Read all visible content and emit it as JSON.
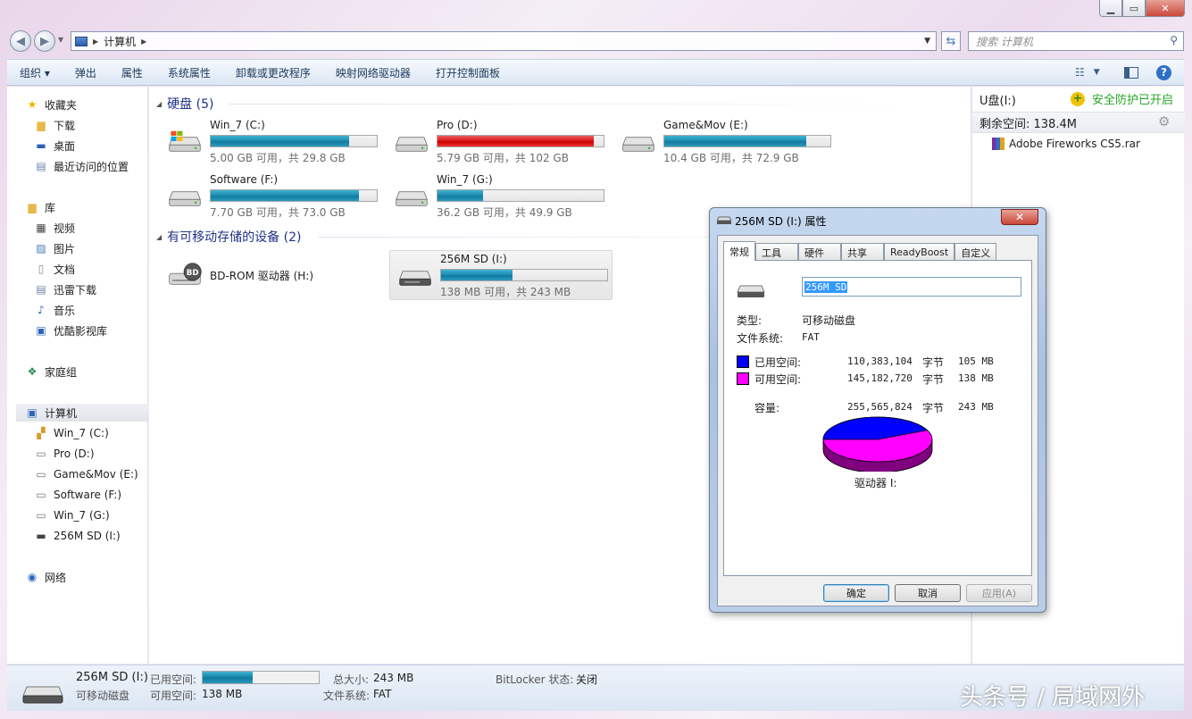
{
  "address": {
    "location": "计算机",
    "search_placeholder": "搜索 计算机"
  },
  "toolbar": [
    "组织",
    "弹出",
    "属性",
    "系统属性",
    "卸载或更改程序",
    "映射网络驱动器",
    "打开控制面板"
  ],
  "nav": {
    "favorites": "收藏夹",
    "downloads": "下载",
    "desktop": "桌面",
    "recent": "最近访问的位置",
    "libraries": "库",
    "videos": "视频",
    "pictures": "图片",
    "documents": "文档",
    "xunlei": "迅雷下载",
    "music": "音乐",
    "youku": "优酷影视库",
    "homegroup": "家庭组",
    "computer": "计算机",
    "drives": [
      "Win_7 (C:)",
      "Pro (D:)",
      "Game&Mov (E:)",
      "Software (F:)",
      "Win_7 (G:)",
      "256M SD (I:)"
    ],
    "network": "网络"
  },
  "groups": {
    "hdd": "硬盘 (5)",
    "removable": "有可移动存储的设备 (2)"
  },
  "drives": [
    {
      "name": "Win_7 (C:)",
      "free": "5.00 GB 可用，共 29.8 GB",
      "used_frac": 0.832
    },
    {
      "name": "Pro (D:)",
      "free": "5.79 GB 可用，共 102 GB",
      "used_frac": 0.943
    },
    {
      "name": "Game&Mov (E:)",
      "free": "10.4 GB 可用，共 72.9 GB",
      "used_frac": 0.857
    },
    {
      "name": "Software (F:)",
      "free": "7.70 GB 可用，共 73.0 GB",
      "used_frac": 0.895
    },
    {
      "name": "Win_7 (G:)",
      "free": "36.2 GB 可用，共 49.9 GB",
      "used_frac": 0.275
    }
  ],
  "removable": {
    "bd": {
      "name": "BD-ROM 驱动器 (H:)",
      "badge": "BD"
    },
    "sd": {
      "name": "256M SD (I:)",
      "free": "138 MB 可用，共 243 MB",
      "used_frac": 0.432
    }
  },
  "pane": {
    "title": "U盘(I:)",
    "safety": "安全防护已开启",
    "remaining": "剩余空间: 138.4M",
    "file": "Adobe Fireworks CS5.rar"
  },
  "status": {
    "name": "256M SD (I:)",
    "type": "可移动磁盘",
    "used_label": "已用空间:",
    "used_frac": 0.432,
    "free_label": "可用空间:",
    "free_value": "138 MB",
    "total_label": "总大小:",
    "total_value": "243 MB",
    "fs_label": "文件系统:",
    "fs_value": "FAT",
    "bitlocker_label": "BitLocker 状态:",
    "bitlocker_value": "关闭"
  },
  "dialog": {
    "title": "256M SD (I:) 属性",
    "tabs": [
      "常规",
      "工具",
      "硬件",
      "共享",
      "ReadyBoost",
      "自定义"
    ],
    "label_value": "256M SD",
    "type_label": "类型:",
    "type_value": "可移动磁盘",
    "fs_label": "文件系统:",
    "fs_value": "FAT",
    "used_label": "已用空间:",
    "used_bytes": "110,383,104",
    "used_mb": "105 MB",
    "free_label": "可用空间:",
    "free_bytes": "145,182,720",
    "free_mb": "138 MB",
    "bytes_unit": "字节",
    "cap_label": "容量:",
    "cap_bytes": "255,565,824",
    "cap_mb": "243 MB",
    "drive_label": "驱动器 I:",
    "used_color": "#0000ff",
    "free_color": "#ff00ff",
    "used_frac": 0.432,
    "ok": "确定",
    "cancel": "取消",
    "apply": "应用(A)"
  },
  "watermark": "头条号 / 局域网外"
}
